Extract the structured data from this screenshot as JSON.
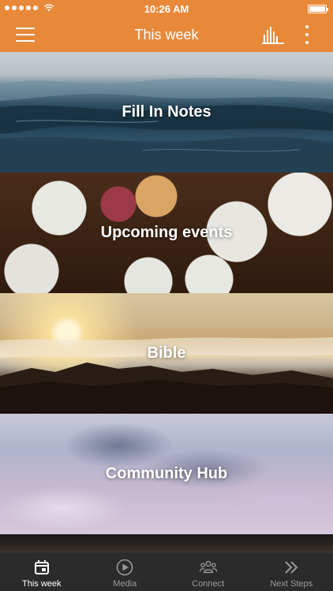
{
  "status_bar": {
    "time": "10:26 AM",
    "signal_dots": 5
  },
  "header": {
    "title": "This week"
  },
  "tiles": [
    {
      "label": "Fill In Notes",
      "image": "ocean-waves"
    },
    {
      "label": "Upcoming events",
      "image": "dinner-table"
    },
    {
      "label": "Bible",
      "image": "mountain-sunrise"
    },
    {
      "label": "Community Hub",
      "image": "sky-clouds"
    }
  ],
  "tab_bar": {
    "items": [
      {
        "label": "This week",
        "icon": "calendar-icon",
        "active": true
      },
      {
        "label": "Media",
        "icon": "play-circle-icon",
        "active": false
      },
      {
        "label": "Connect",
        "icon": "people-icon",
        "active": false
      },
      {
        "label": "Next Steps",
        "icon": "double-chevron-icon",
        "active": false
      }
    ]
  },
  "colors": {
    "brand": "#E8893A",
    "tab_bar": "#2b2b2b",
    "tab_active": "#ffffff",
    "tab_inactive": "#9a9a9a"
  }
}
